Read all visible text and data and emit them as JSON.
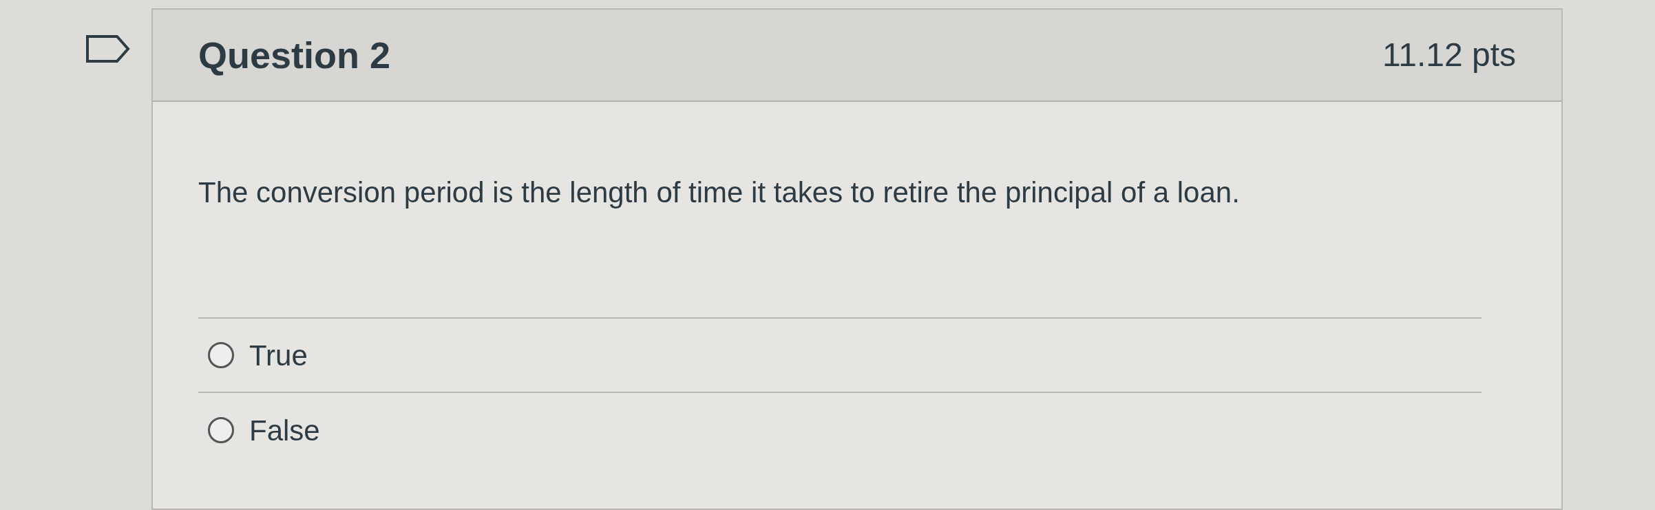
{
  "question": {
    "title": "Question 2",
    "points": "11.12 pts",
    "flagged": false,
    "text": "The conversion period is the length of time it takes to retire the principal of a loan.",
    "answers": [
      {
        "label": "True",
        "selected": false
      },
      {
        "label": "False",
        "selected": false
      }
    ]
  }
}
